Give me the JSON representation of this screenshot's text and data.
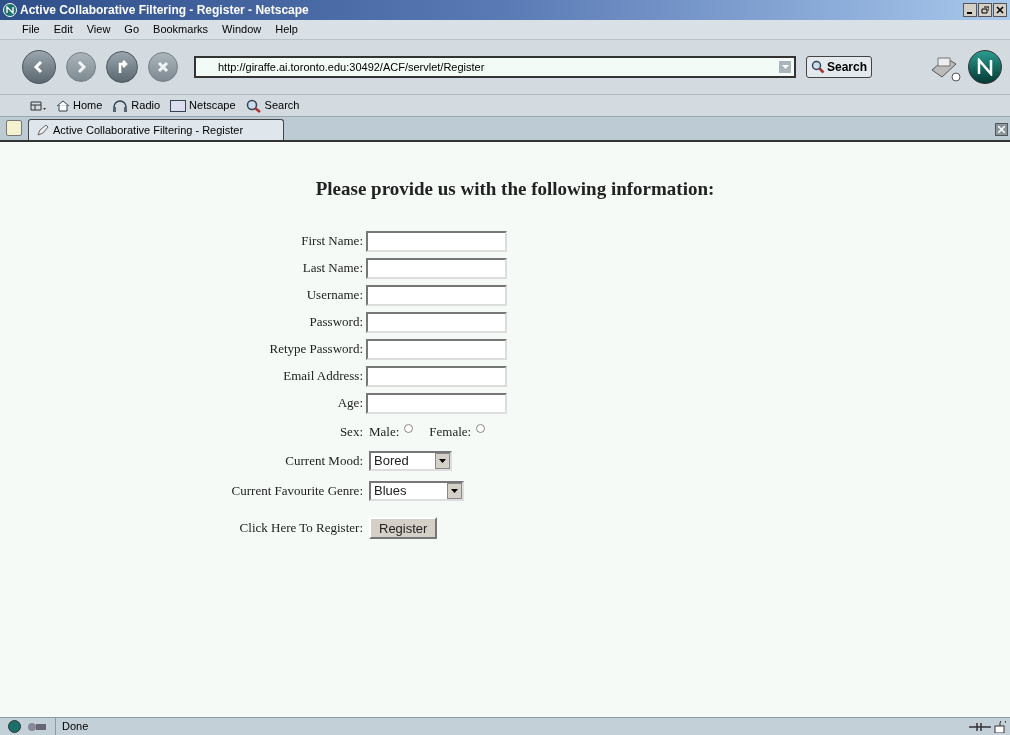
{
  "window": {
    "title": "Active Collaborative Filtering - Register - Netscape"
  },
  "menu": [
    "File",
    "Edit",
    "View",
    "Go",
    "Bookmarks",
    "Window",
    "Help"
  ],
  "address": {
    "value": "http://giraffe.ai.toronto.edu:30492/ACF/servlet/Register"
  },
  "search_button": "Search",
  "personal_toolbar": [
    "Home",
    "Radio",
    "Netscape",
    "Search"
  ],
  "tab": {
    "label": "Active Collaborative Filtering - Register",
    "selected": true
  },
  "page": {
    "heading": "Please provide us with the following information:",
    "rows": [
      {
        "kind": "text",
        "label": "First Name:"
      },
      {
        "kind": "text",
        "label": "Last Name:"
      },
      {
        "kind": "text",
        "label": "Username:"
      },
      {
        "kind": "text",
        "label": "Password:"
      },
      {
        "kind": "text",
        "label": "Retype Password:"
      },
      {
        "kind": "text",
        "label": "Email Address:"
      },
      {
        "kind": "text",
        "label": "Age:"
      },
      {
        "kind": "radio",
        "label": "Sex:",
        "options": [
          {
            "label": "Male:",
            "selected": false
          },
          {
            "label": "Female:",
            "selected": false
          }
        ]
      },
      {
        "kind": "select",
        "label": "Current Mood:",
        "value": "Bored"
      },
      {
        "kind": "select",
        "label": "Current Favourite Genre:",
        "value": "Blues",
        "wide": true
      },
      {
        "kind": "button",
        "label": "Click Here To Register:",
        "button": "Register"
      }
    ]
  },
  "status_bar": {
    "text": "Done"
  }
}
